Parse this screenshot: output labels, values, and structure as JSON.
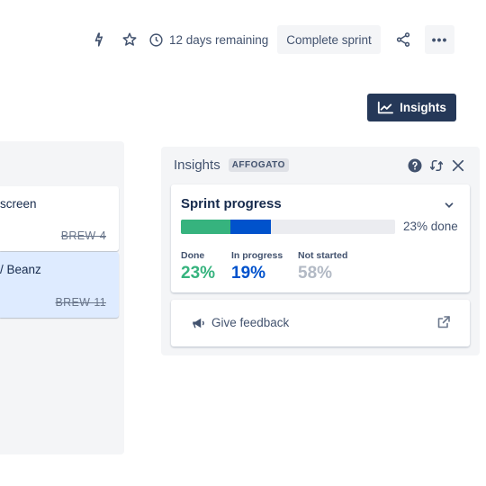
{
  "toolbar": {
    "icons": [
      "lightning-icon",
      "star-icon",
      "clock-icon",
      "share-icon",
      "more-icon"
    ],
    "remaining_text": "12 days remaining",
    "complete_label": "Complete sprint",
    "more_label": "•••"
  },
  "insights_button": {
    "label": "Insights"
  },
  "column": {
    "cards": [
      {
        "title": "screen",
        "key": "BREW-4",
        "selected": false
      },
      {
        "title": "/ Beanz",
        "key": "BREW-11",
        "selected": true
      }
    ]
  },
  "panel": {
    "title": "Insights",
    "lozenge": "AFFOGATO",
    "sprint_progress": {
      "title": "Sprint progress",
      "percent_label": "23% done",
      "done_fraction": 0.23,
      "in_progress_fraction": 0.19,
      "stats": [
        {
          "label": "Done",
          "value": "23%"
        },
        {
          "label": "In progress",
          "value": "19%"
        },
        {
          "label": "Not started",
          "value": "58%"
        }
      ]
    },
    "feedback": {
      "label": "Give feedback"
    }
  },
  "colors": {
    "accent_dark": "#253858",
    "done": "#36b37e",
    "in_progress": "#0052cc",
    "not_started": "#b3bac5",
    "selected_card": "#deebff"
  }
}
